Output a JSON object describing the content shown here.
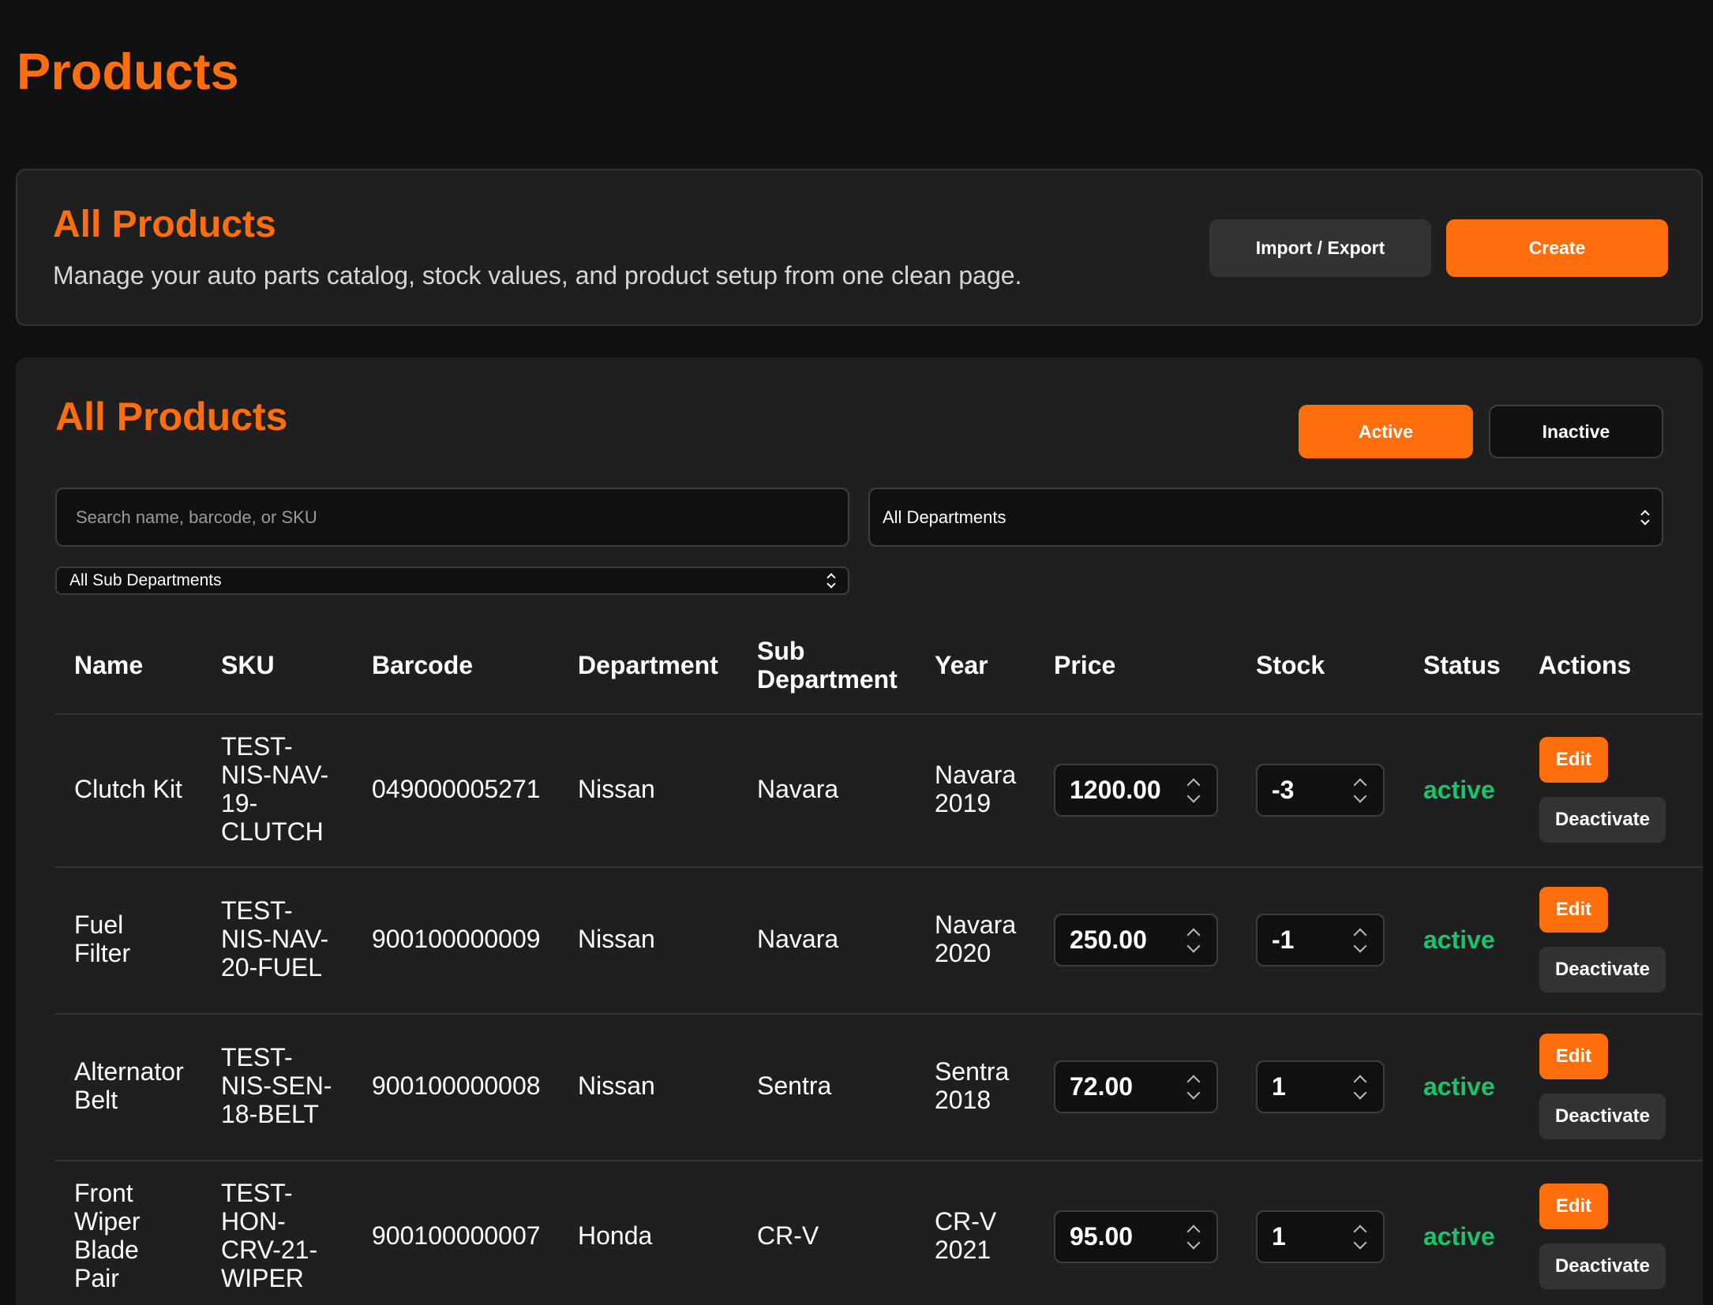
{
  "page": {
    "title": "Products"
  },
  "header_card": {
    "title": "All Products",
    "subtitle": "Manage your auto parts catalog, stock values, and product setup from one clean page.",
    "import_export_label": "Import / Export",
    "create_label": "Create"
  },
  "list_card": {
    "title": "All Products",
    "filter_active_label": "Active",
    "filter_inactive_label": "Inactive",
    "search_placeholder": "Search name, barcode, or SKU",
    "department_select": "All Departments",
    "sub_department_select": "All Sub Departments"
  },
  "table": {
    "headers": {
      "name": "Name",
      "sku": "SKU",
      "barcode": "Barcode",
      "department": "Department",
      "sub_department_1": "Sub",
      "sub_department_2": "Department",
      "year": "Year",
      "price": "Price",
      "stock": "Stock",
      "status": "Status",
      "actions": "Actions"
    },
    "rows": [
      {
        "name_lines": [
          "Clutch Kit"
        ],
        "sku_lines": [
          "TEST-",
          "NIS-NAV-",
          "19-",
          "CLUTCH"
        ],
        "barcode": "049000005271",
        "department": "Nissan",
        "sub_department": "Navara",
        "year_lines": [
          "Navara",
          "2019"
        ],
        "price": "1200.00",
        "stock": "-3",
        "status": "active",
        "edit_label": "Edit",
        "deactivate_label": "Deactivate"
      },
      {
        "name_lines": [
          "Fuel",
          "Filter"
        ],
        "sku_lines": [
          "TEST-",
          "NIS-NAV-",
          "20-FUEL"
        ],
        "barcode": "900100000009",
        "department": "Nissan",
        "sub_department": "Navara",
        "year_lines": [
          "Navara",
          "2020"
        ],
        "price": "250.00",
        "stock": "-1",
        "status": "active",
        "edit_label": "Edit",
        "deactivate_label": "Deactivate"
      },
      {
        "name_lines": [
          "Alternator",
          "Belt"
        ],
        "sku_lines": [
          "TEST-",
          "NIS-SEN-",
          "18-BELT"
        ],
        "barcode": "900100000008",
        "department": "Nissan",
        "sub_department": "Sentra",
        "year_lines": [
          "Sentra",
          "2018"
        ],
        "price": "72.00",
        "stock": "1",
        "status": "active",
        "edit_label": "Edit",
        "deactivate_label": "Deactivate"
      },
      {
        "name_lines": [
          "Front",
          "Wiper",
          "Blade",
          "Pair"
        ],
        "sku_lines": [
          "TEST-",
          "HON-",
          "CRV-21-",
          "WIPER"
        ],
        "barcode": "900100000007",
        "department": "Honda",
        "sub_department": "CR-V",
        "year_lines": [
          "CR-V",
          "2021"
        ],
        "price": "95.00",
        "stock": "1",
        "status": "active",
        "edit_label": "Edit",
        "deactivate_label": "Deactivate"
      }
    ]
  },
  "colors": {
    "accent": "#ff6e0d",
    "background": "#111111",
    "card": "#1f1f1f",
    "status_active": "#19c56a"
  }
}
